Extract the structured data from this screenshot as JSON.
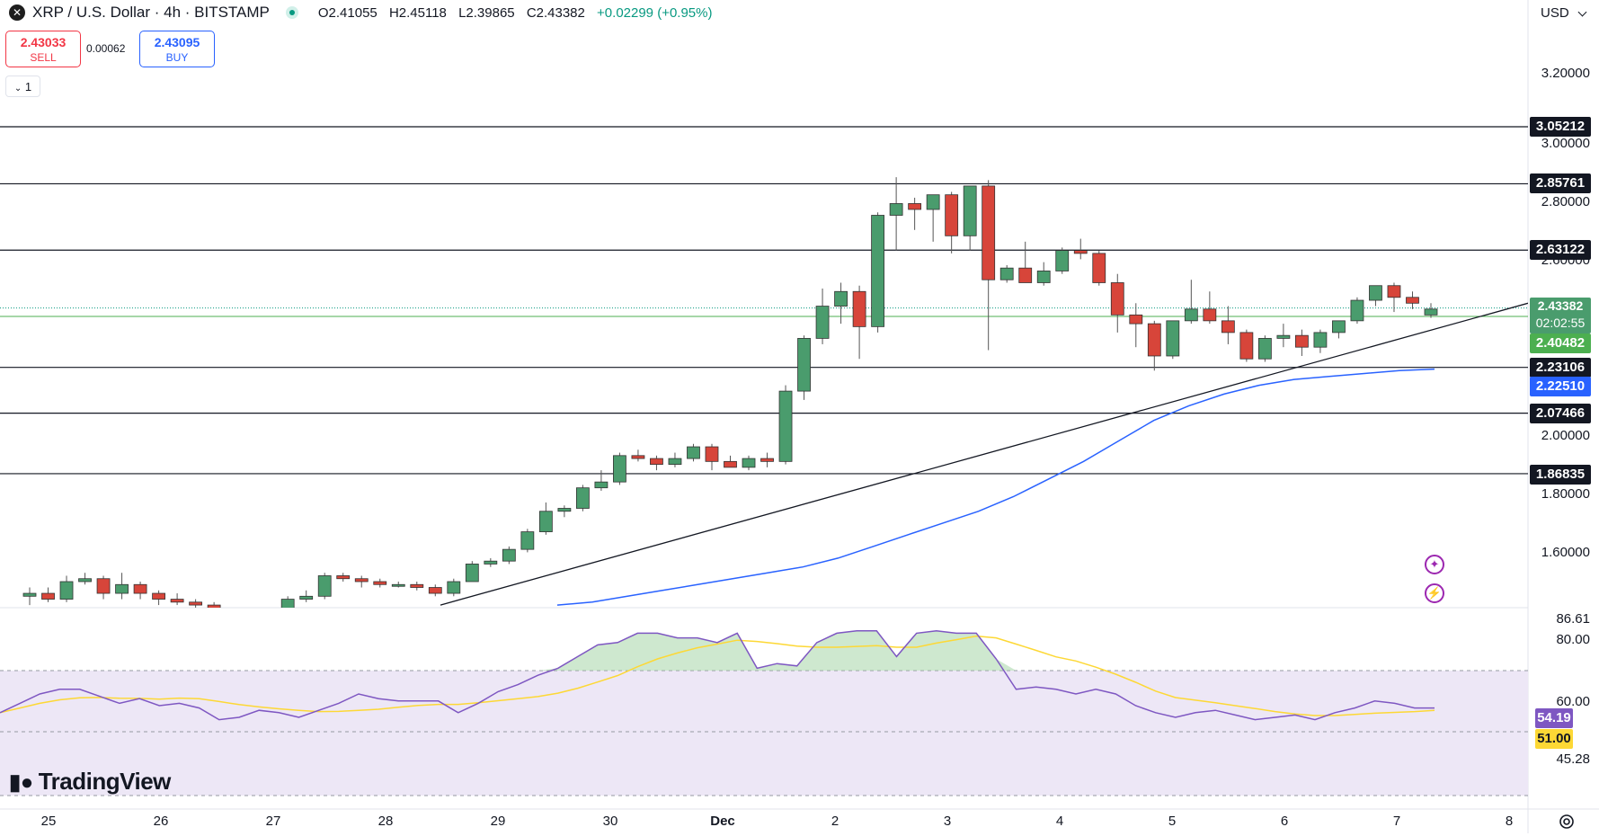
{
  "header": {
    "logo_glyph": "✕",
    "symbol_title": "XRP / U.S. Dollar · 4h · BITSTAMP",
    "ohlc": {
      "open": "O2.41055",
      "high": "H2.45118",
      "low": "L2.39865",
      "close": "C2.43382",
      "change": "+0.02299 (+0.95%)"
    }
  },
  "trade": {
    "sell_price": "2.43033",
    "sell_label": "SELL",
    "spread": "0.00062",
    "buy_price": "2.43095",
    "buy_label": "BUY",
    "collapse_label": "1"
  },
  "currency": "USD",
  "price_axis": [
    "3.20000",
    "3.00000",
    "2.80000",
    "2.60000",
    "2.00000",
    "1.80000",
    "1.60000"
  ],
  "level_tags": [
    "3.05212",
    "2.85761",
    "2.63122",
    "2.23106",
    "2.07466",
    "1.86835"
  ],
  "current_price": {
    "value": "2.43382",
    "countdown": "02:02:55"
  },
  "ma_tags": {
    "green": "2.40482",
    "blue": "2.22510"
  },
  "rsi_axis": [
    "86.61",
    "80.00",
    "60.00",
    "45.28"
  ],
  "rsi_tags": {
    "rsi": "54.19",
    "ma": "51.00"
  },
  "time_axis": [
    "25",
    "26",
    "27",
    "28",
    "29",
    "30",
    "Dec",
    "2",
    "3",
    "4",
    "5",
    "6",
    "7",
    "8"
  ],
  "brand": "TradingView",
  "colors": {
    "up": "#089981",
    "candle_up": "#4a9c6d",
    "candle_down": "#d7453a",
    "level_line": "#131722",
    "ma_blue": "#2962ff",
    "ma_green": "#4caf50",
    "rsi_line": "#7e57c2",
    "rsi_ma": "#fdd835",
    "rsi_band": "#ede7f6"
  },
  "chart_data": {
    "type": "candlestick",
    "symbol": "XRP / U.S. Dollar",
    "interval": "4h",
    "exchange": "BITSTAMP",
    "x": [
      "Nov 25",
      "Nov 26",
      "Nov 27",
      "Nov 28",
      "Nov 29",
      "Nov 30",
      "Dec 1",
      "Dec 2",
      "Dec 3",
      "Dec 4",
      "Dec 5",
      "Dec 6",
      "Dec 7"
    ],
    "horizontal_levels": [
      3.05212,
      2.85761,
      2.63122,
      2.23106,
      2.07466,
      1.86835
    ],
    "current_price": 2.43382,
    "moving_average": 2.2251,
    "rsi": {
      "value": 54.19,
      "ma": 51.0,
      "upper": 70,
      "lower": 30
    },
    "candles": [
      [
        1.45,
        1.48,
        1.42,
        1.46
      ],
      [
        1.46,
        1.48,
        1.43,
        1.44
      ],
      [
        1.44,
        1.52,
        1.43,
        1.5
      ],
      [
        1.5,
        1.53,
        1.49,
        1.51
      ],
      [
        1.51,
        1.52,
        1.44,
        1.46
      ],
      [
        1.46,
        1.53,
        1.44,
        1.49
      ],
      [
        1.49,
        1.5,
        1.44,
        1.46
      ],
      [
        1.46,
        1.47,
        1.42,
        1.44
      ],
      [
        1.44,
        1.46,
        1.42,
        1.43
      ],
      [
        1.43,
        1.44,
        1.4,
        1.42
      ],
      [
        1.42,
        1.43,
        1.38,
        1.39
      ],
      [
        1.39,
        1.4,
        1.36,
        1.37
      ],
      [
        1.37,
        1.38,
        1.35,
        1.36
      ],
      [
        1.36,
        1.38,
        1.34,
        1.37
      ],
      [
        1.37,
        1.45,
        1.36,
        1.44
      ],
      [
        1.44,
        1.47,
        1.43,
        1.45
      ],
      [
        1.45,
        1.53,
        1.44,
        1.52
      ],
      [
        1.52,
        1.53,
        1.5,
        1.51
      ],
      [
        1.51,
        1.52,
        1.48,
        1.5
      ],
      [
        1.5,
        1.51,
        1.48,
        1.49
      ],
      [
        1.49,
        1.5,
        1.48,
        1.49
      ],
      [
        1.49,
        1.5,
        1.47,
        1.48
      ],
      [
        1.48,
        1.49,
        1.45,
        1.46
      ],
      [
        1.46,
        1.51,
        1.45,
        1.5
      ],
      [
        1.5,
        1.57,
        1.5,
        1.56
      ],
      [
        1.56,
        1.58,
        1.55,
        1.57
      ],
      [
        1.57,
        1.62,
        1.56,
        1.61
      ],
      [
        1.61,
        1.68,
        1.6,
        1.67
      ],
      [
        1.67,
        1.77,
        1.66,
        1.74
      ],
      [
        1.74,
        1.76,
        1.72,
        1.75
      ],
      [
        1.75,
        1.83,
        1.74,
        1.82
      ],
      [
        1.82,
        1.88,
        1.81,
        1.84
      ],
      [
        1.84,
        1.94,
        1.83,
        1.93
      ],
      [
        1.93,
        1.95,
        1.91,
        1.92
      ],
      [
        1.92,
        1.93,
        1.88,
        1.9
      ],
      [
        1.9,
        1.94,
        1.89,
        1.92
      ],
      [
        1.92,
        1.97,
        1.91,
        1.96
      ],
      [
        1.96,
        1.97,
        1.88,
        1.91
      ],
      [
        1.91,
        1.93,
        1.89,
        1.89
      ],
      [
        1.89,
        1.93,
        1.88,
        1.92
      ],
      [
        1.92,
        1.94,
        1.89,
        1.91
      ],
      [
        1.91,
        2.17,
        1.9,
        2.15
      ],
      [
        2.15,
        2.34,
        2.12,
        2.33
      ],
      [
        2.33,
        2.5,
        2.31,
        2.44
      ],
      [
        2.44,
        2.52,
        2.38,
        2.49
      ],
      [
        2.49,
        2.51,
        2.26,
        2.37
      ],
      [
        2.37,
        2.76,
        2.35,
        2.75
      ],
      [
        2.75,
        2.88,
        2.63,
        2.79
      ],
      [
        2.79,
        2.81,
        2.7,
        2.77
      ],
      [
        2.77,
        2.82,
        2.66,
        2.82
      ],
      [
        2.82,
        2.83,
        2.62,
        2.68
      ],
      [
        2.68,
        2.85,
        2.63,
        2.85
      ],
      [
        2.85,
        2.87,
        2.29,
        2.53
      ],
      [
        2.53,
        2.58,
        2.52,
        2.57
      ],
      [
        2.57,
        2.66,
        2.52,
        2.52
      ],
      [
        2.52,
        2.59,
        2.51,
        2.56
      ],
      [
        2.56,
        2.64,
        2.55,
        2.63
      ],
      [
        2.63,
        2.67,
        2.6,
        2.62
      ],
      [
        2.62,
        2.63,
        2.51,
        2.52
      ],
      [
        2.52,
        2.55,
        2.35,
        2.41
      ],
      [
        2.41,
        2.45,
        2.3,
        2.38
      ],
      [
        2.38,
        2.39,
        2.22,
        2.27
      ],
      [
        2.27,
        2.39,
        2.26,
        2.39
      ],
      [
        2.39,
        2.53,
        2.38,
        2.43
      ],
      [
        2.43,
        2.49,
        2.38,
        2.39
      ],
      [
        2.39,
        2.44,
        2.31,
        2.35
      ],
      [
        2.35,
        2.36,
        2.25,
        2.26
      ],
      [
        2.26,
        2.34,
        2.25,
        2.33
      ],
      [
        2.33,
        2.38,
        2.3,
        2.34
      ],
      [
        2.34,
        2.36,
        2.27,
        2.3
      ],
      [
        2.3,
        2.36,
        2.28,
        2.35
      ],
      [
        2.35,
        2.39,
        2.33,
        2.39
      ],
      [
        2.39,
        2.47,
        2.38,
        2.46
      ],
      [
        2.46,
        2.5,
        2.44,
        2.51
      ],
      [
        2.51,
        2.52,
        2.42,
        2.47
      ],
      [
        2.47,
        2.49,
        2.43,
        2.45
      ],
      [
        2.41,
        2.45,
        2.4,
        2.43
      ]
    ],
    "ma_series": [
      1.42,
      1.43,
      1.45,
      1.47,
      1.49,
      1.51,
      1.53,
      1.55,
      1.58,
      1.62,
      1.66,
      1.7,
      1.74,
      1.79,
      1.85,
      1.91,
      1.98,
      2.05,
      2.1,
      2.14,
      2.17,
      2.19,
      2.2,
      2.21,
      2.22,
      2.225
    ],
    "rsi_series": [
      52,
      56,
      60,
      62,
      62,
      59,
      56,
      58,
      55,
      56,
      54,
      49,
      50,
      53,
      52,
      50,
      53,
      56,
      60,
      58,
      57,
      57,
      57,
      52,
      56,
      61,
      64,
      68,
      71,
      76,
      81,
      82,
      86,
      86,
      84,
      84,
      82,
      86,
      71,
      73,
      72,
      82,
      86,
      87,
      87,
      76,
      86,
      87,
      86,
      86,
      75,
      62,
      63,
      62,
      60,
      62,
      60,
      55,
      52,
      50,
      52,
      53,
      51,
      49,
      50,
      51,
      49,
      52,
      54,
      57,
      56,
      54,
      54
    ]
  }
}
